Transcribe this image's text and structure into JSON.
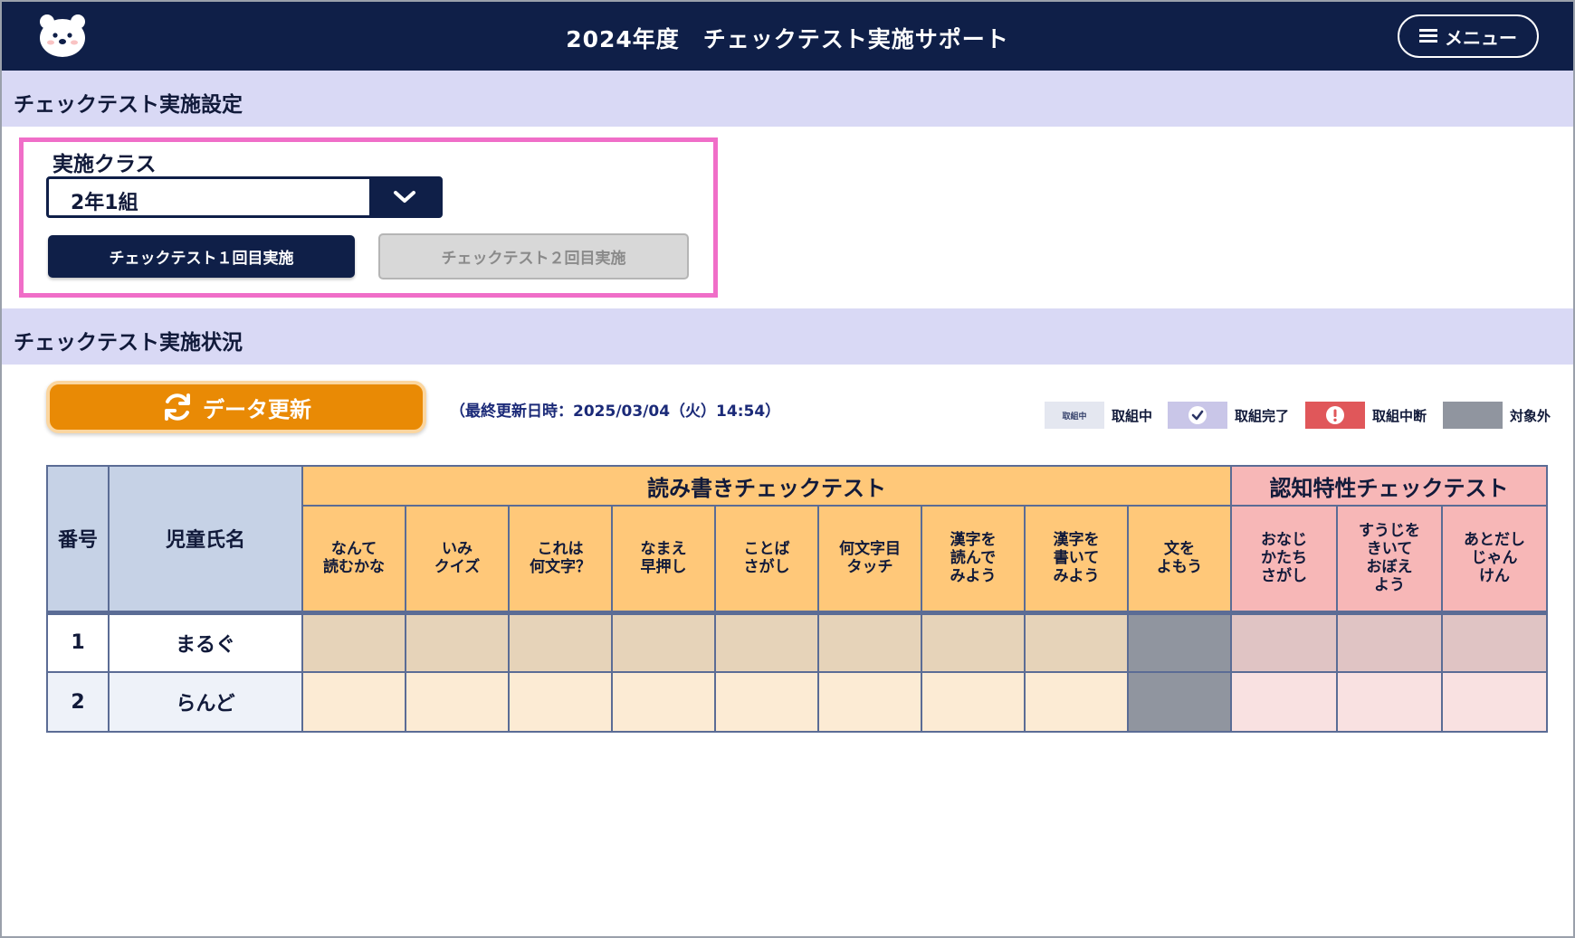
{
  "header": {
    "title": "2024年度　チェックテスト実施サポート",
    "menu_label": "メニュー"
  },
  "settings": {
    "section_title": "チェックテスト実施設定",
    "class_label": "実施クラス",
    "class_value": "2年1組",
    "btn_test1": "チェックテスト１回目実施",
    "btn_test2": "チェックテスト２回目実施"
  },
  "status": {
    "section_title": "チェックテスト実施状況",
    "refresh_label": "データ更新",
    "last_update": "（最終更新日時：2025/03/04（火）14:54）",
    "legend": {
      "in_progress_badge": "取組中",
      "in_progress": "取組中",
      "done": "取組完了",
      "interrupted": "取組中断",
      "not_applicable": "対象外"
    }
  },
  "table": {
    "col_number": "番号",
    "col_name": "児童氏名",
    "group_rw": "読み書きチェックテスト",
    "group_cog": "認知特性チェックテスト",
    "rw_tests": [
      "なんて\n読むかな",
      "いみ\nクイズ",
      "これは\n何文字？",
      "なまえ\n早押し",
      "ことば\nさがし",
      "何文字目\nタッチ",
      "漢字を\n読んで\nみよう",
      "漢字を\n書いて\nみよう",
      "文を\nよもう"
    ],
    "cog_tests": [
      "おなじ\nかたち\nさがし",
      "すうじを\nきいて\nおぼえ\nよう",
      "あとだし\nじゃん\nけん"
    ],
    "rows": [
      {
        "number": "1",
        "name": "まるぐ"
      },
      {
        "number": "2",
        "name": "らんど"
      }
    ]
  },
  "colors": {
    "navy": "#0f1f48",
    "section_bg": "#d9d9f5",
    "highlight": "#f06ec8",
    "orange": "#e98a05",
    "rw_header": "#ffc879",
    "cog_header": "#f7b7b7",
    "done": "#c9c6e8",
    "interrupted": "#e0575a",
    "not_applicable": "#90959f"
  }
}
